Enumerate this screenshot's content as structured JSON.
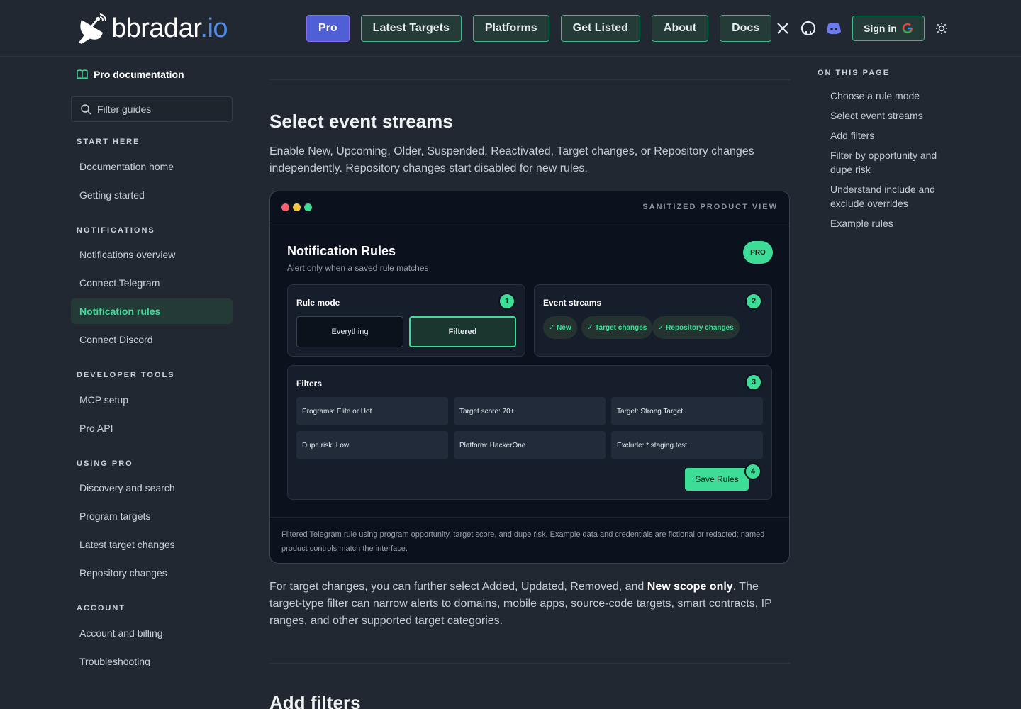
{
  "brand": {
    "name_white": "bbradar",
    "name_blue": ".io"
  },
  "nav": {
    "items": [
      {
        "label": "Pro"
      },
      {
        "label": "Latest Targets"
      },
      {
        "label": "Platforms"
      },
      {
        "label": "Get Listed"
      },
      {
        "label": "About"
      },
      {
        "label": "Docs"
      }
    ],
    "social_icons": [
      "x-icon",
      "github-icon",
      "discord-icon"
    ],
    "signin_label": "Sign in"
  },
  "sidebar": {
    "heading": "Pro documentation",
    "filter_placeholder": "Filter guides",
    "sections": [
      {
        "title": "START HERE",
        "items": [
          "Documentation home",
          "Getting started"
        ]
      },
      {
        "title": "NOTIFICATIONS",
        "items": [
          "Notifications overview",
          "Connect Telegram",
          "Notification rules",
          "Connect Discord"
        ]
      },
      {
        "title": "DEVELOPER TOOLS",
        "items": [
          "MCP setup",
          "Pro API"
        ]
      },
      {
        "title": "USING PRO",
        "items": [
          "Discovery and search",
          "Program targets",
          "Latest target changes",
          "Repository changes"
        ]
      },
      {
        "title": "ACCOUNT",
        "items": [
          "Account and billing",
          "Troubleshooting"
        ]
      }
    ],
    "active_item": "Notification rules"
  },
  "main": {
    "heading": "Select event streams",
    "intro": "Enable New, Upcoming, Older, Suspended, Reactivated, Target changes, or Repository changes independently. Repository changes start disabled for new rules.",
    "product_view": {
      "tag": "SANITIZED PRODUCT VIEW",
      "title": "Notification Rules",
      "subtitle": "Alert only when a saved rule matches",
      "badge": "PRO",
      "rule_mode": {
        "title": "Rule mode",
        "step": "1",
        "options": [
          "Everything",
          "Filtered"
        ],
        "selected": "Filtered"
      },
      "event_streams": {
        "title": "Event streams",
        "step": "2",
        "chips": [
          "✓ New",
          "✓ Target changes",
          "✓ Repository changes"
        ]
      },
      "filters": {
        "title": "Filters",
        "step": "3",
        "items": [
          "Programs: Elite or Hot",
          "Target score: 70+",
          "Target: Strong Target",
          "Dupe risk: Low",
          "Platform: HackerOne",
          "Exclude: *.staging.test"
        ],
        "save_label": "Save Rules",
        "save_step": "4"
      },
      "caption": "Filtered Telegram rule using program opportunity, target score, and dupe risk. Example data and credentials are fictional or redacted; named product controls match the interface."
    },
    "after_pre": "For target changes, you can further select Added, Updated, Removed, and ",
    "after_bold": "New scope only",
    "after_post": ". The target-type filter can narrow alerts to domains, mobile apps, source-code targets, smart contracts, IP ranges, and other supported target categories.",
    "next_heading": "Add filters"
  },
  "toc": {
    "title": "ON THIS PAGE",
    "items": [
      "Choose a rule mode",
      "Select event streams",
      "Add filters",
      "Filter by opportunity and dupe risk",
      "Understand include and exclude overrides",
      "Example rules"
    ]
  },
  "colors": {
    "accent": "#3ddc97",
    "brand_blue": "#4f8be8",
    "pro_button": "#4f5fd6",
    "background": "#222831"
  }
}
